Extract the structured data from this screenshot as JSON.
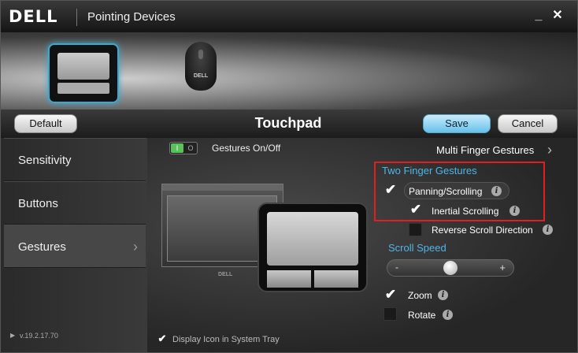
{
  "window": {
    "brand": "DELL",
    "title": "Pointing Devices",
    "minimize_glyph": "_",
    "close_glyph": "✕"
  },
  "devices": {
    "mouse_brand": "DELL"
  },
  "toolbar": {
    "default_label": "Default",
    "page_title": "Touchpad",
    "save_label": "Save",
    "cancel_label": "Cancel"
  },
  "sidebar": {
    "items": [
      {
        "label": "Sensitivity"
      },
      {
        "label": "Buttons"
      },
      {
        "label": "Gestures"
      }
    ],
    "active": "Gestures",
    "version": "v.19.2.17.70"
  },
  "gestures": {
    "toggle_on": "I",
    "toggle_off": "O",
    "toggle_label": "Gestures On/Off",
    "multi_finger_link": "Multi Finger Gestures",
    "two_finger_title": "Two Finger Gestures",
    "panning_label": "Panning/Scrolling",
    "panning_checked": true,
    "inertial_label": "Inertial Scrolling",
    "inertial_checked": true,
    "reverse_label": "Reverse Scroll Direction",
    "reverse_checked": false,
    "scroll_speed_title": "Scroll Speed",
    "scroll_speed_minus": "-",
    "scroll_speed_plus": "+",
    "scroll_speed_level": 0.5,
    "zoom_label": "Zoom",
    "zoom_checked": true,
    "rotate_label": "Rotate",
    "rotate_checked": false,
    "illustration_brand": "DELL"
  },
  "footer": {
    "tray_label": "Display Icon in System Tray",
    "tray_checked": true
  },
  "colors": {
    "accent": "#4eb6ea",
    "highlight_box": "#e02020",
    "toggle_on": "#5bc15b"
  }
}
